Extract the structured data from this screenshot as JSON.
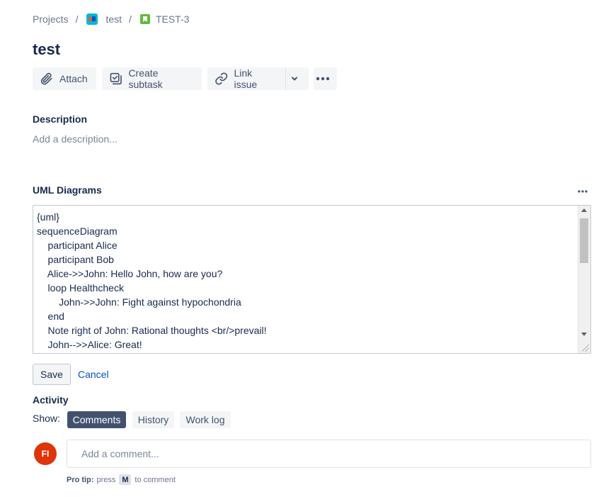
{
  "breadcrumb": {
    "projects": "Projects",
    "separator": "/",
    "project_name": "test",
    "project_icon": "project-avatar-icon",
    "issue_key": "TEST-3",
    "issue_icon": "story-icon"
  },
  "issue": {
    "title": "test"
  },
  "toolbar": {
    "attach": "Attach",
    "create_subtask": "Create subtask",
    "link_issue": "Link issue"
  },
  "description": {
    "label": "Description",
    "placeholder": "Add a description..."
  },
  "uml": {
    "label": "UML Diagrams",
    "content": "{uml}\nsequenceDiagram\n    participant Alice\n    participant Bob\n    Alice->>John: Hello John, how are you?\n    loop Healthcheck\n        John->>John: Fight against hypochondria\n    end\n    Note right of John: Rational thoughts <br/>prevail!\n    John-->>Alice: Great!",
    "save": "Save",
    "cancel": "Cancel"
  },
  "activity": {
    "label": "Activity",
    "show": "Show:",
    "tabs": [
      "Comments",
      "History",
      "Work log"
    ],
    "selected_tab": "Comments"
  },
  "comment": {
    "avatar_initials": "FI",
    "placeholder": "Add a comment...",
    "protip_label": "Pro tip:",
    "protip_press": "press",
    "protip_key": "M",
    "protip_suffix": "to comment"
  },
  "colors": {
    "accent": "#0052cc",
    "selected_chip": "#42526e",
    "avatar": "#de350b"
  }
}
